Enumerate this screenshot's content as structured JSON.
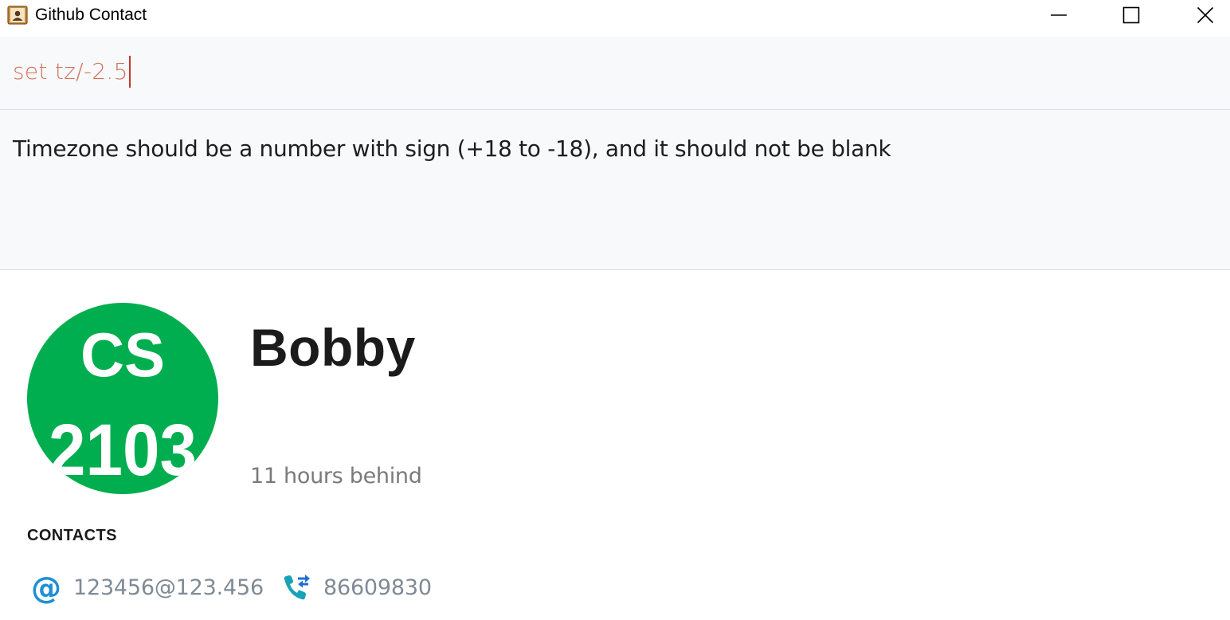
{
  "window": {
    "title": "Github Contact",
    "icon": "address-book-icon",
    "controls": [
      "minimize",
      "maximize",
      "close"
    ]
  },
  "command_box": {
    "value": "set tz/-2.5"
  },
  "result_display": {
    "message": "Timezone should be a number with sign (+18 to -18), and it should not be blank"
  },
  "contact": {
    "avatar_text_top": "CS",
    "avatar_text_bottom": "2103",
    "avatar_color": "#00ae4f",
    "name": "Bobby",
    "time_difference": "11 hours behind",
    "contacts_heading": "CONTACTS",
    "email": "123456@123.456",
    "phone": "86609830",
    "email_icon": "at-sign-icon",
    "phone_icon": "call-transfer-icon"
  },
  "colors": {
    "command_text": "#d3715b",
    "panel_background": "#f8f9fa",
    "icon_blue": "#1d8fd6"
  }
}
